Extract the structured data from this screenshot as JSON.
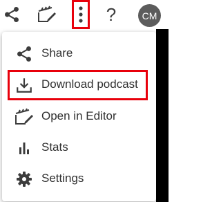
{
  "toolbar": {
    "share_icon": "share-icon",
    "editor_icon": "open-in-editor-icon",
    "more_icon": "more-vertical-icon",
    "help_label": "?",
    "avatar_initials": "CM"
  },
  "menu": {
    "items": [
      {
        "label": "Share",
        "icon": "share-icon"
      },
      {
        "label": "Download podcast",
        "icon": "download-icon"
      },
      {
        "label": "Open in Editor",
        "icon": "open-in-editor-icon"
      },
      {
        "label": "Stats",
        "icon": "stats-icon"
      },
      {
        "label": "Settings",
        "icon": "gear-icon"
      }
    ]
  },
  "colors": {
    "icon": "#3c3c3c",
    "highlight": "#e8000b",
    "avatar_bg": "#5c5c5c"
  }
}
